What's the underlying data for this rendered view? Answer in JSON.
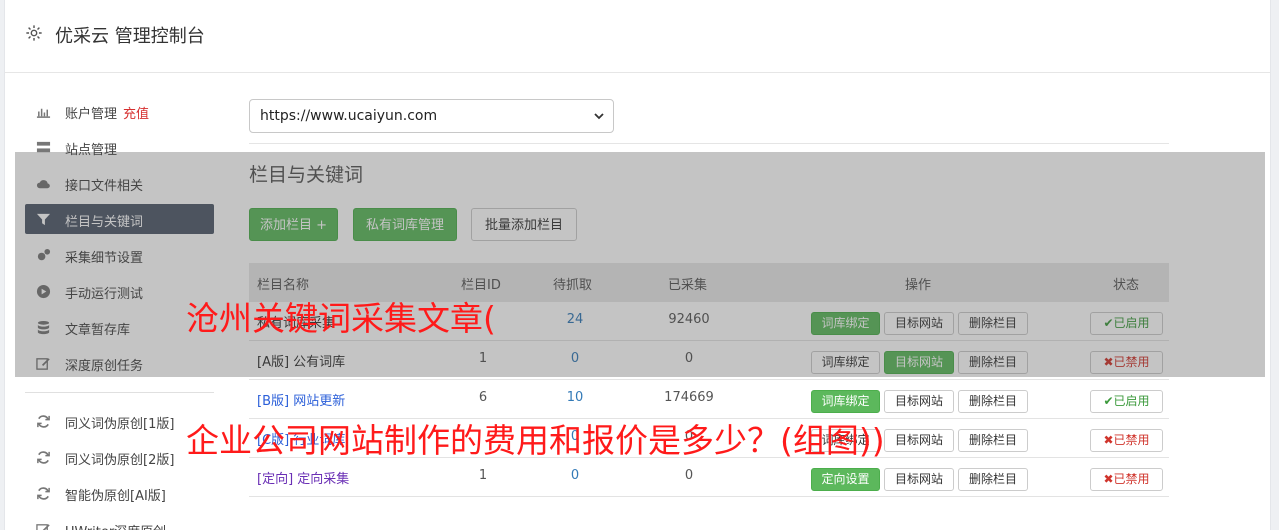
{
  "header": {
    "title": "优采云 管理控制台",
    "icon": "gear-icon"
  },
  "sidebar": {
    "items": [
      {
        "label": "账户管理",
        "extra": "充值",
        "icon": "bar-chart-icon"
      },
      {
        "label": "站点管理",
        "icon": "server-icon"
      },
      {
        "label": "接口文件相关",
        "icon": "cloud-upload-icon"
      },
      {
        "label": "栏目与关键词",
        "icon": "filter-icon",
        "active": true
      },
      {
        "label": "采集细节设置",
        "icon": "cogs-icon"
      },
      {
        "label": "手动运行测试",
        "icon": "play-circle-icon"
      },
      {
        "label": "文章暂存库",
        "icon": "database-icon"
      },
      {
        "label": "深度原创任务",
        "icon": "edit-icon"
      },
      {
        "label": "同义词伪原创[1版]",
        "icon": "refresh-icon"
      },
      {
        "label": "同义词伪原创[2版]",
        "icon": "refresh-icon"
      },
      {
        "label": "智能伪原创[AI版]",
        "icon": "refresh-icon"
      },
      {
        "label": "UWriter深度原创",
        "icon": "edit-icon"
      }
    ]
  },
  "site_select": {
    "value": "https://www.ucaiyun.com"
  },
  "section": {
    "title": "栏目与关键词",
    "add_button": "添加栏目 +",
    "private_lib_button": "私有词库管理",
    "batch_add_button": "批量添加栏目"
  },
  "table": {
    "headers": [
      "栏目名称",
      "栏目ID",
      "待抓取",
      "已采集",
      "操作",
      "状态"
    ],
    "rows": [
      {
        "name": "私有词库采集",
        "id": "",
        "pending": "24",
        "done": "92460",
        "btn1": "词库绑定",
        "btn2": "目标网站",
        "btn3": "删除栏目",
        "status": "已启用"
      },
      {
        "name": "[A版] 公有词库",
        "id": "1",
        "pending": "0",
        "done": "0",
        "btn1": "词库绑定",
        "btn2": "目标网站",
        "btn3": "删除栏目",
        "status": "已禁用"
      },
      {
        "name": "[B版] 网站更新",
        "id": "6",
        "pending": "10",
        "done": "174669",
        "btn1": "词库绑定",
        "btn2": "目标网站",
        "btn3": "删除栏目",
        "status": "已启用"
      },
      {
        "name": "[C版] 行业词库",
        "id": "",
        "pending": "0",
        "done": "0",
        "btn1": "词库绑定",
        "btn2": "目标网站",
        "btn3": "删除栏目",
        "status": "已禁用"
      },
      {
        "name": "[定向] 定向采集",
        "id": "1",
        "pending": "0",
        "done": "0",
        "btn1": "定向设置",
        "btn2": "目标网站",
        "btn3": "删除栏目",
        "status": "已禁用"
      }
    ]
  },
  "watermark": {
    "line1": "沧州关键词采集文章(",
    "line2": "企业公司网站制作的费用和报价是多少？(组图))"
  },
  "colors": {
    "accent_green": "#5cb85c",
    "active_nav": "#505a6b",
    "watermark": "#ff1a1a",
    "danger": "#d0342c"
  }
}
